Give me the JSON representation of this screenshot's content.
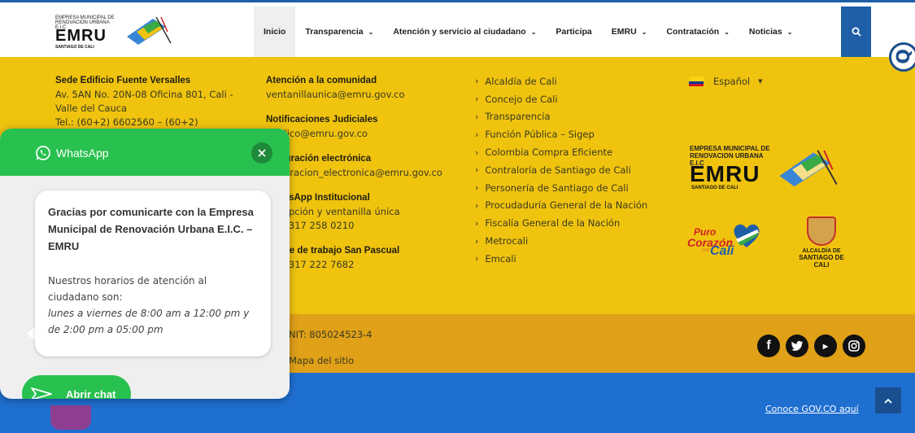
{
  "colors": {
    "accent_blue": "#1f5fa8",
    "yellow": "#f0c30f",
    "orange": "#e0a018",
    "footer_blue": "#1f6fd1",
    "whatsapp_green": "#28c14f"
  },
  "header": {
    "logo": {
      "line1": "EMPRESA MUNICIPAL DE",
      "line2": "RENOVACION URBANA E.I.C",
      "name": "EMRU",
      "city": "SANTIAGO DE CALI"
    },
    "nav": [
      {
        "label": "Inicio",
        "dropdown": false
      },
      {
        "label": "Transparencia",
        "dropdown": true
      },
      {
        "label": "Atención y servicio al ciudadano",
        "dropdown": true
      },
      {
        "label": "Participa",
        "dropdown": false
      },
      {
        "label": "EMRU",
        "dropdown": true
      },
      {
        "label": "Contratación",
        "dropdown": true
      },
      {
        "label": "Noticias",
        "dropdown": true
      }
    ],
    "search_icon": "search-icon",
    "accessibility_icon": "accessibility-icon"
  },
  "footer_info": {
    "sede": {
      "title": "Sede Edificio Fuente Versalles",
      "address": "Av. 5AN No. 20N-08 Oficina 801, Cali - Valle del Cauca",
      "tel": "Tel.: (60+2) 6602560 – (60+2) 6602562"
    },
    "comunidad": {
      "title": "Atención a la comunidad",
      "email": "ventanillaunica@emru.gov.co"
    },
    "notificaciones": {
      "title": "Notificaciones Judiciales",
      "email": "juridico@emru.gov.co"
    },
    "facturacion": {
      "title": "Facturación electrónica",
      "email": "facturacion_electronica@emru.gov.co"
    },
    "whatsapp": {
      "title": "WhatsApp Institucional",
      "desc": "Recepción y ventanilla única",
      "phone": "+57 317 258 0210"
    },
    "sanpascual": {
      "title": "Frente de trabajo San Pascual",
      "phone": "+57 317 222 7682"
    },
    "links": [
      "Alcaldía de Cali",
      "Concejo de Cali",
      "Transparencia",
      "Función Pública – Sigep",
      "Colombia Compra Eficiente",
      "Contraloría de Santiago de Cali",
      "Personería de Santiago de Cali",
      "Procudaduría General de la Nación",
      "Fiscalía General de la Nación",
      "Metrocali",
      "Emcali"
    ],
    "language": "Español",
    "logo2": {
      "line1": "EMPRESA MUNICIPAL DE",
      "line2": "RENOVACION URBANA E.I.C",
      "name": "EMRU",
      "city": "SANTIAGO DE CALI"
    },
    "puro": {
      "l1": "Puro",
      "l2": "Corazón",
      "l3": "por",
      "l4": "Cali"
    },
    "alcaldia": {
      "l1": "ALCALDÍA DE",
      "l2": "SANTIAGO DE CALI"
    }
  },
  "band": {
    "nit": "NIT: 805024523-4",
    "mapa": "Mapa del sitio",
    "social": [
      "facebook-icon",
      "twitter-icon",
      "youtube-icon",
      "instagram-icon"
    ]
  },
  "footer": {
    "gov_link": "Conoce GOV.CO aquí"
  },
  "whatsapp_widget": {
    "title": "WhatsApp",
    "greeting": "Gracias por comunicarte con la Empresa Municipal de Renovación Urbana E.I.C. – EMRU",
    "hours_label": "Nuestros horarios de atención al ciudadano son:",
    "schedule": "lunes a viernes de 8:00 am a 12:00 pm y de 2:00 pm a 05:00 pm",
    "open_button": "Abrir chat"
  }
}
